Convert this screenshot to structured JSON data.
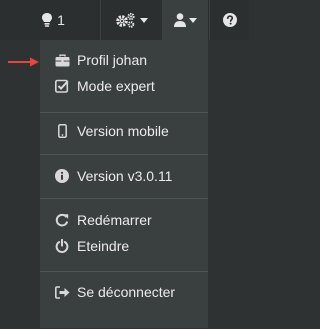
{
  "topbar": {
    "notifications_count": "1",
    "icons": {
      "notifications": "lightbulb-icon",
      "settings": "cogs-icon",
      "user": "user-icon",
      "help": "question-circle-icon"
    }
  },
  "user_menu": {
    "items": [
      {
        "label": "Profil johan",
        "icon": "briefcase-icon"
      },
      {
        "label": "Mode expert",
        "icon": "check-square-icon"
      },
      {
        "label": "Version mobile",
        "icon": "mobile-icon"
      },
      {
        "label": "Version v3.0.11",
        "icon": "info-circle-icon"
      },
      {
        "label": "Redémarrer",
        "icon": "refresh-icon"
      },
      {
        "label": "Eteindre",
        "icon": "power-off-icon"
      },
      {
        "label": "Se déconnecter",
        "icon": "sign-out-icon"
      }
    ]
  },
  "colors": {
    "background": "#2e3233",
    "menu_background": "#3a3f40",
    "text": "#ececec",
    "annotation_arrow": "#e8453c"
  }
}
